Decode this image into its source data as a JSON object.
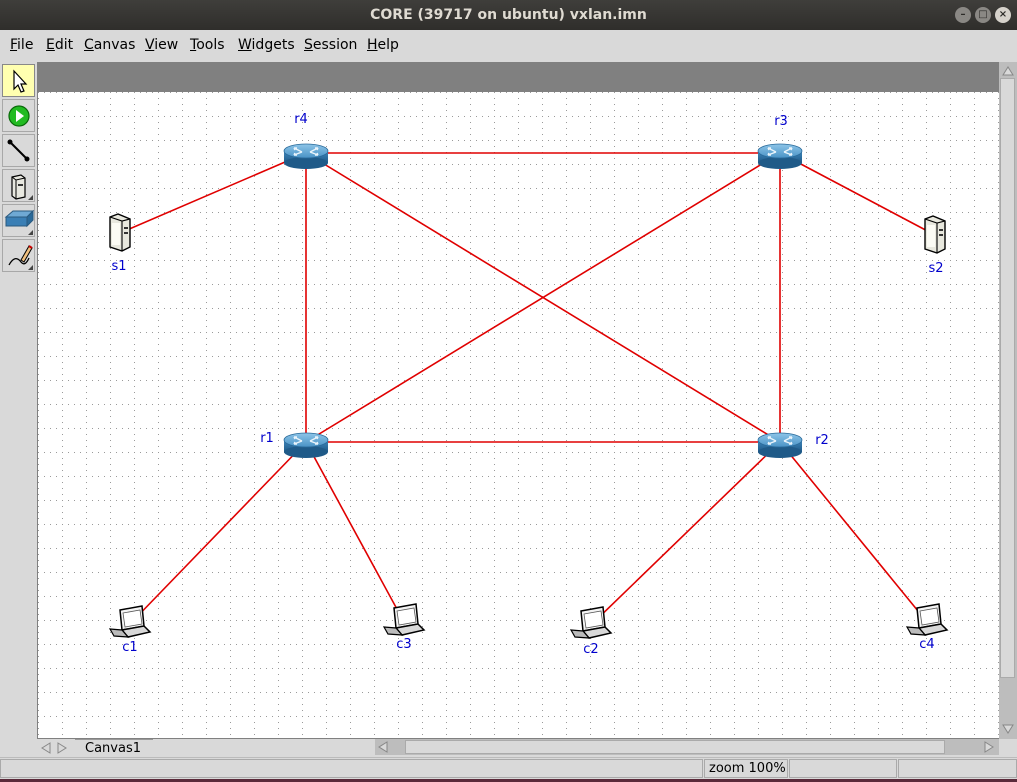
{
  "window": {
    "title": "CORE (39717 on ubuntu) vxlan.imn",
    "buttons": {
      "minimize": "–",
      "maximize": "□",
      "close": "×"
    }
  },
  "menu": [
    {
      "id": "file",
      "label": "File",
      "mnemonic": "F",
      "rest": "ile"
    },
    {
      "id": "edit",
      "label": "Edit",
      "mnemonic": "E",
      "rest": "dit"
    },
    {
      "id": "canvas",
      "label": "Canvas",
      "mnemonic": "C",
      "rest": "anvas"
    },
    {
      "id": "view",
      "label": "View",
      "mnemonic": "V",
      "rest": "iew"
    },
    {
      "id": "tools",
      "label": "Tools",
      "mnemonic": "T",
      "rest": "ools"
    },
    {
      "id": "widgets",
      "label": "Widgets",
      "mnemonic": "W",
      "rest": "idgets"
    },
    {
      "id": "session",
      "label": "Session",
      "mnemonic": "S",
      "rest": "ession"
    },
    {
      "id": "help",
      "label": "Help",
      "mnemonic": "H",
      "rest": "elp"
    }
  ],
  "toolbar": [
    {
      "id": "select",
      "icon": "pointer-arrow-icon",
      "active": true
    },
    {
      "id": "start",
      "icon": "play-circle-icon",
      "active": false
    },
    {
      "id": "link",
      "icon": "link-line-icon",
      "active": false
    },
    {
      "id": "network-layer",
      "icon": "server-node-icon",
      "active": false
    },
    {
      "id": "link-layer",
      "icon": "switch-hub-icon",
      "active": false
    },
    {
      "id": "annotation",
      "icon": "pencil-marker-icon",
      "active": false
    }
  ],
  "topology": {
    "nodes": [
      {
        "id": "r4",
        "label": "r4",
        "type": "router"
      },
      {
        "id": "r3",
        "label": "r3",
        "type": "router"
      },
      {
        "id": "r1",
        "label": "r1",
        "type": "router"
      },
      {
        "id": "r2",
        "label": "r2",
        "type": "router"
      },
      {
        "id": "s1",
        "label": "s1",
        "type": "server"
      },
      {
        "id": "s2",
        "label": "s2",
        "type": "server"
      },
      {
        "id": "c1",
        "label": "c1",
        "type": "laptop"
      },
      {
        "id": "c3",
        "label": "c3",
        "type": "laptop"
      },
      {
        "id": "c2",
        "label": "c2",
        "type": "laptop"
      },
      {
        "id": "c4",
        "label": "c4",
        "type": "laptop"
      }
    ],
    "links": [
      [
        "r4",
        "r3"
      ],
      [
        "r4",
        "r1"
      ],
      [
        "r4",
        "r2"
      ],
      [
        "r4",
        "s1"
      ],
      [
        "r3",
        "r1"
      ],
      [
        "r3",
        "r2"
      ],
      [
        "r3",
        "s2"
      ],
      [
        "r1",
        "r2"
      ],
      [
        "r1",
        "c1"
      ],
      [
        "r1",
        "c3"
      ],
      [
        "r2",
        "c2"
      ],
      [
        "r2",
        "c4"
      ]
    ],
    "link_color": "#e00000",
    "label_color": "#0000cc"
  },
  "tabs": {
    "active": "Canvas1"
  },
  "status": {
    "zoom": "zoom 100%"
  }
}
